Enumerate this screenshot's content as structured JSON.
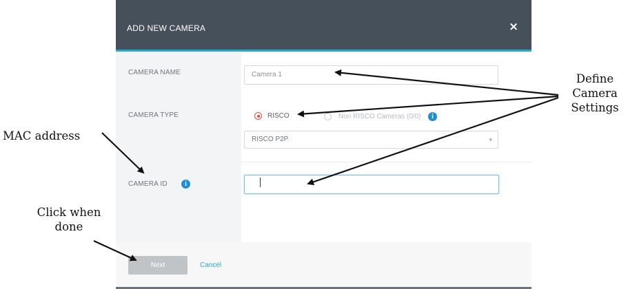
{
  "dialog": {
    "title": "ADD NEW CAMERA",
    "close_glyph": "×",
    "fields": {
      "camera_name": {
        "label": "CAMERA NAME",
        "value": "Camera 1"
      },
      "camera_type": {
        "label": "CAMERA TYPE",
        "options": [
          {
            "label": "RISCO",
            "selected": true
          },
          {
            "label": "Non RISCO Cameras (0/0)",
            "selected": false
          }
        ],
        "model_select": {
          "value": "RISCO P2P"
        }
      },
      "camera_id": {
        "label": "CAMERA ID",
        "value": ""
      }
    },
    "footer": {
      "next_label": "Next",
      "cancel_label": "Cancel"
    }
  },
  "annotations": {
    "define_settings": [
      "Define",
      "Camera",
      "Settings"
    ],
    "mac_address": "MAC address",
    "click_when_done": [
      "Click when",
      "done"
    ]
  },
  "icons": {
    "info": "info-icon",
    "close": "close-icon",
    "dropdown": "chevron-down-icon"
  },
  "colors": {
    "header": "#45505a",
    "accent": "#2aa7c9",
    "radio_selected": "#e64b3c",
    "info": "#1f8fd1"
  }
}
